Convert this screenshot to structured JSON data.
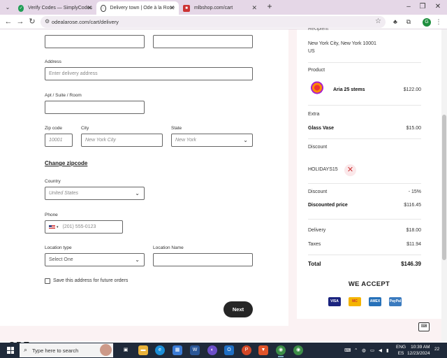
{
  "browser": {
    "tabs": [
      {
        "title": "Verify Codes — SimplyCodes",
        "active": false
      },
      {
        "title": "Delivery town | Ode à la Rose",
        "active": true
      },
      {
        "title": "mlbshop.com/cart",
        "active": false
      }
    ],
    "url": "odealarose.com/cart/delivery",
    "profile_initial": "G"
  },
  "form": {
    "address_label": "Address",
    "address_placeholder": "Enter delivery address",
    "apt_label": "Apt / Suite / Room",
    "zip_label": "Zip code",
    "zip_value": "10001",
    "city_label": "City",
    "city_value": "New York City",
    "state_label": "State",
    "state_value": "New York",
    "change_zip": "Change zipcode",
    "country_label": "Country",
    "country_value": "United States",
    "phone_label": "Phone",
    "phone_placeholder": "(201) 555-0123",
    "location_type_label": "Location type",
    "location_type_value": "Select One",
    "location_name_label": "Location Name",
    "save_address": "Save this address for future orders",
    "next": "Next"
  },
  "summary": {
    "recipient_heading": "Recipient",
    "recipient_city": "New York City, New York 10001",
    "recipient_country": "US",
    "product_heading": "Product",
    "product_name": "Aria 25 stems",
    "product_price": "$122.00",
    "extra_heading": "Extra",
    "extra_name": "Glass Vase",
    "extra_price": "$15.00",
    "discount_heading": "Discount",
    "discount_code": "HOLIDAYS15",
    "discount_label": "Discount",
    "discount_value": "- 15%",
    "discounted_label": "Discounted price",
    "discounted_value": "$116.45",
    "delivery_label": "Delivery",
    "delivery_value": "$18.00",
    "taxes_label": "Taxes",
    "taxes_value": "$11.94",
    "total_label": "Total",
    "total_value": "$146.39",
    "we_accept": "WE ACCEPT",
    "cards": [
      "VISA",
      "MC",
      "AMEX",
      "PayPal"
    ]
  },
  "footer_logo_peek": "ODE",
  "taskbar": {
    "search_placeholder": "Type here to search",
    "lang": "ENG",
    "region": "ES",
    "time": "10:39 AM",
    "date": "12/23/2024",
    "notifications": "22"
  },
  "colors": {
    "tab_strip": "#e5d7e7",
    "page_bg": "#fbf2f3",
    "next_button": "#262626",
    "remove_accent": "#cc3333",
    "taskbar": "#1f2a3a"
  }
}
